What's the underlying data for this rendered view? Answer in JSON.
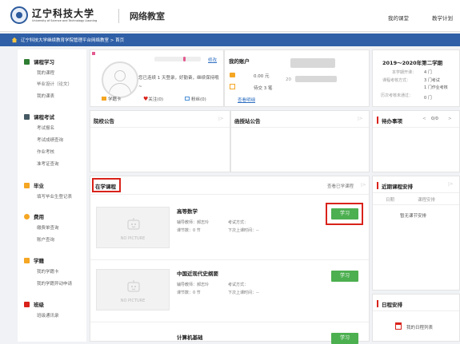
{
  "header": {
    "university_name": "辽宁科技大学",
    "university_en": "University of Science and Technology Liaoning",
    "site_name": "网络教室",
    "nav_links": [
      "我的课堂",
      "教学计划"
    ]
  },
  "breadcrumb": "辽宁科技大学继续教育学院管理平台网络教室 > 首页",
  "sidebar": {
    "groups": [
      {
        "label": "课程学习",
        "color": "#2e7d32",
        "items": [
          "我的课程",
          "毕业设计（论文）",
          "我的课表"
        ]
      },
      {
        "label": "课程考试",
        "color": "#455a64",
        "items": [
          "考试报名",
          "考试成绩查询",
          "作业考核",
          "准考证查询"
        ]
      },
      {
        "label": "毕业",
        "color": "#f5a623",
        "items": [
          "填写毕业生登记表"
        ]
      },
      {
        "label": "费用",
        "color": "#f5a623",
        "items": [
          "缴费单查询",
          "账户查询"
        ]
      },
      {
        "label": "学籍",
        "color": "#f5a623",
        "items": [
          "我的学籍卡",
          "我的学籍异动申请"
        ]
      },
      {
        "label": "班级",
        "color": "#d9221a",
        "items": [
          "班级通讯录"
        ]
      }
    ]
  },
  "profile": {
    "edit_label": "修改",
    "welcome": "您已连续 1 天登录，好勤奋，继续保持哦~",
    "stats": [
      {
        "icon": "card-icon",
        "label": "学籍卡",
        "color": "#f5a623"
      },
      {
        "icon": "heart-icon",
        "label": "关注(0)",
        "color": "#d9221a"
      },
      {
        "icon": "fans-icon",
        "label": "粉丝(0)",
        "color": "#4a8fd6"
      }
    ]
  },
  "account": {
    "title": "我的账户",
    "balance": "0.00 元",
    "pending": "待交 3 笔",
    "detail_link": "查看明细",
    "blurred_label": "20"
  },
  "semester": {
    "title": "2019～2020年第二学期",
    "rows": [
      {
        "label": "本学期开课：",
        "value": "4 门"
      },
      {
        "label": "课程考核方式：",
        "value": "3 门考试"
      },
      {
        "label": "",
        "value": "1 门作业考核"
      },
      {
        "label": "历次考核未通过：",
        "value": "0 门"
      }
    ]
  },
  "notices": {
    "college_title": "院校公告",
    "site_title": "函授站公告",
    "todo_title": "待办事项",
    "todo_count": "0/0"
  },
  "courses": {
    "section_title": "在学课程",
    "view_all": "查看已学课程",
    "no_picture": "NO PICTURE",
    "study_label": "学习",
    "list": [
      {
        "title": "高等数学",
        "teacher_label": "辅导教师：",
        "teacher": "郝志玲",
        "exam_label": "考试方式：",
        "exam": "",
        "count_label": "课节数：",
        "count": "0 节",
        "next_label": "下次上课时间：",
        "next": "--"
      },
      {
        "title": "中国近现代史纲要",
        "teacher_label": "辅导教师：",
        "teacher": "郝志玲",
        "exam_label": "考试方式：",
        "exam": "",
        "count_label": "课节数：",
        "count": "0 节",
        "next_label": "下次上课时间：",
        "next": "--"
      },
      {
        "title": "计算机基础",
        "teacher_label": "",
        "teacher": "",
        "exam_label": "",
        "exam": "",
        "count_label": "",
        "count": "",
        "next_label": "",
        "next": ""
      }
    ]
  },
  "schedule": {
    "title": "近期课程安排",
    "col_date": "日期",
    "col_course": "课程安排",
    "empty": "暂无课节安排"
  },
  "calendar": {
    "title": "日程安排",
    "button": "我的日程列表"
  }
}
